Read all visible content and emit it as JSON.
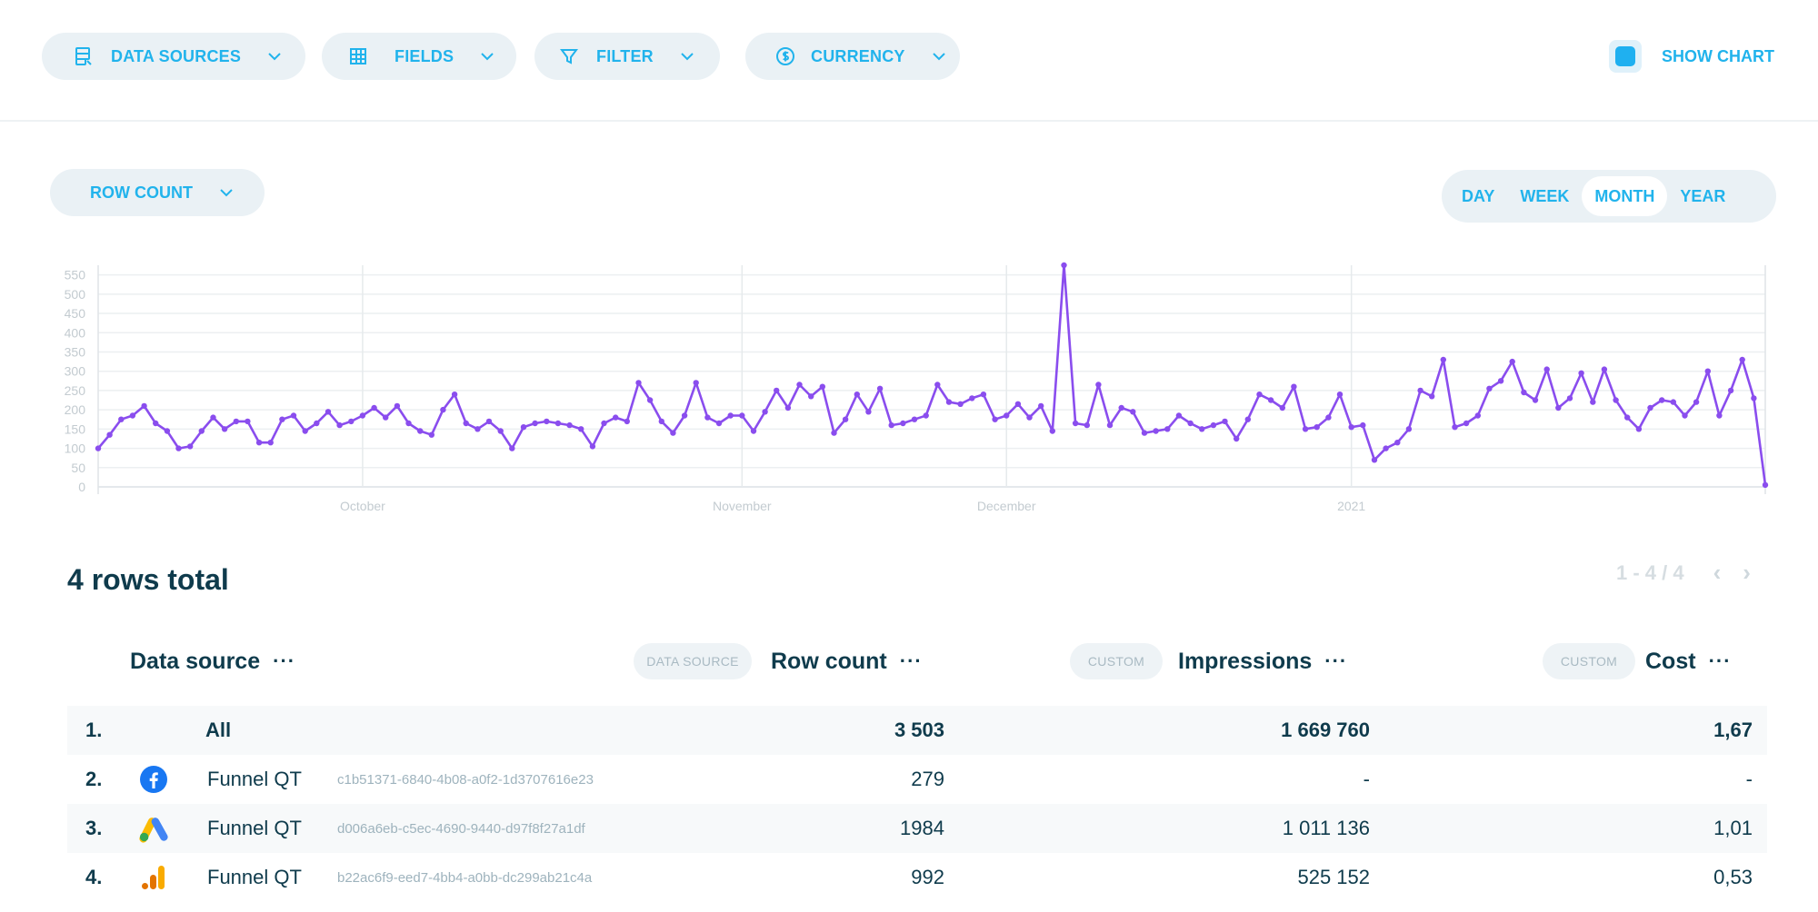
{
  "toolbar": {
    "data_sources": "DATA SOURCES",
    "fields": "FIELDS",
    "filter": "FILTER",
    "currency": "CURRENCY",
    "show_chart": "SHOW CHART"
  },
  "metric_select": "ROW COUNT",
  "periods": [
    "DAY",
    "WEEK",
    "MONTH",
    "YEAR"
  ],
  "active_period": "MONTH",
  "chart_data": {
    "type": "line",
    "color": "#8a4dee",
    "y_ticks": [
      "550",
      "500",
      "450",
      "400",
      "350",
      "300",
      "250",
      "200",
      "150",
      "100",
      "50",
      "0"
    ],
    "ylim": [
      0,
      575
    ],
    "x_labels": [
      "October",
      "November",
      "December",
      "2021"
    ],
    "values": [
      100,
      135,
      175,
      185,
      210,
      165,
      145,
      100,
      105,
      145,
      180,
      150,
      170,
      170,
      115,
      115,
      175,
      185,
      145,
      165,
      195,
      160,
      170,
      185,
      205,
      180,
      210,
      165,
      145,
      135,
      200,
      240,
      165,
      150,
      170,
      145,
      100,
      155,
      165,
      170,
      165,
      160,
      150,
      105,
      165,
      180,
      170,
      270,
      225,
      170,
      140,
      185,
      270,
      180,
      165,
      185,
      185,
      145,
      195,
      250,
      205,
      265,
      235,
      260,
      140,
      175,
      240,
      195,
      255,
      160,
      165,
      175,
      185,
      265,
      220,
      215,
      230,
      240,
      175,
      185,
      215,
      180,
      210,
      145,
      575,
      165,
      160,
      265,
      160,
      205,
      195,
      140,
      145,
      150,
      185,
      165,
      150,
      160,
      170,
      125,
      175,
      240,
      225,
      205,
      260,
      150,
      155,
      180,
      240,
      155,
      160,
      70,
      100,
      115,
      150,
      250,
      235,
      330,
      155,
      165,
      185,
      255,
      275,
      325,
      245,
      225,
      305,
      205,
      230,
      295,
      220,
      305,
      225,
      180,
      150,
      205,
      225,
      220,
      185,
      220,
      300,
      185,
      250,
      330,
      230,
      5
    ]
  },
  "table": {
    "total_label": "4 rows total",
    "pagination": "1 - 4 / 4",
    "columns": {
      "source": "Data source",
      "row_count": "Row count",
      "impressions": "Impressions",
      "cost": "Cost",
      "badge_data_source": "DATA SOURCE",
      "badge_custom_1": "CUSTOM",
      "badge_custom_2": "CUSTOM",
      "more": "···"
    },
    "rows": [
      {
        "index": "1.",
        "name": "All",
        "uuid": "",
        "row_count": "3 503",
        "impressions": "1 669 760",
        "cost": "1,67",
        "icon": "none"
      },
      {
        "index": "2.",
        "name": "Funnel QT",
        "uuid": "c1b51371-6840-4b08-a0f2-1d3707616e23",
        "row_count": "279",
        "impressions": "-",
        "cost": "-",
        "icon": "facebook-icon"
      },
      {
        "index": "3.",
        "name": "Funnel QT",
        "uuid": "d006a6eb-c5ec-4690-9440-d97f8f27a1df",
        "row_count": "1984",
        "impressions": "1 011 136",
        "cost": "1,01",
        "icon": "google-ads-icon"
      },
      {
        "index": "4.",
        "name": "Funnel QT",
        "uuid": "b22ac6f9-eed7-4bb4-a0bb-dc299ab21c4a",
        "row_count": "992",
        "impressions": "525 152",
        "cost": "0,53",
        "icon": "google-analytics-icon"
      }
    ]
  }
}
